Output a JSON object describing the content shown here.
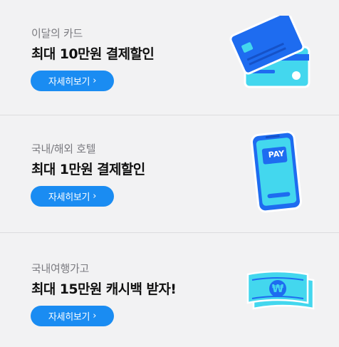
{
  "promos": [
    {
      "subtitle": "이달의 카드",
      "title": "최대 10만원 결제할인",
      "button_label": "자세히보기",
      "button_chevron": "›",
      "icon": "credit-cards-icon"
    },
    {
      "subtitle": "국내/해외 호텔",
      "title": "최대 1만원 결제할인",
      "button_label": "자세히보기",
      "button_chevron": "›",
      "icon": "phone-pay-icon",
      "icon_text": "PAY"
    },
    {
      "subtitle": "국내여행가고",
      "title": "최대 15만원 캐시백 받자!",
      "button_label": "자세히보기",
      "button_chevron": "›",
      "icon": "cash-bills-icon",
      "icon_text": "₩"
    }
  ],
  "colors": {
    "background": "#f2f2f3",
    "button": "#1a8cf2",
    "accent_blue": "#1e6cf0",
    "accent_cyan": "#43d7ee"
  }
}
